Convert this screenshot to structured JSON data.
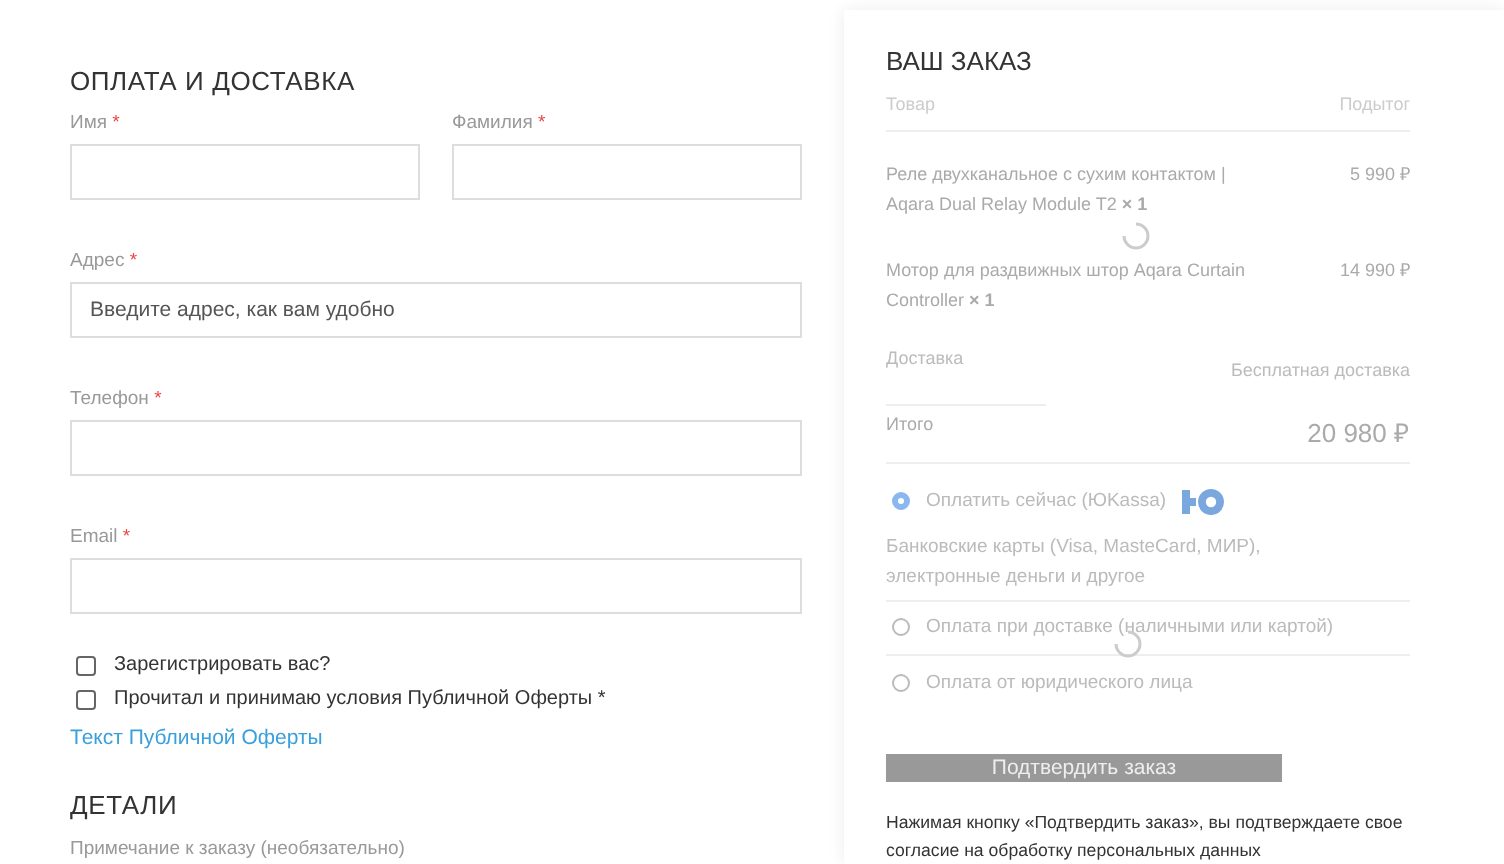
{
  "billing": {
    "title": "ОПЛАТА И ДОСТАВКА",
    "name_fields": [
      {
        "label": "Имя",
        "required": "*"
      },
      {
        "label": "Фамилия",
        "required": "*"
      }
    ],
    "fields": [
      {
        "label": "Адрес",
        "required": "*",
        "placeholder": "Введите адрес, как вам удобно"
      },
      {
        "label": "Телефон",
        "required": "*"
      },
      {
        "label": "Email",
        "required": "*"
      }
    ],
    "checkboxes": [
      {
        "label": "Зарегистрировать вас?",
        "checked": false
      },
      {
        "label": "Прочитал и принимаю условия Публичной Оферты *",
        "checked": false
      }
    ],
    "link": "Текст Публичной Оферты"
  },
  "details": {
    "title": "ДЕТАЛИ",
    "note_label": "Примечание к заказу (необязательно)"
  },
  "order": {
    "title": "ВАШ ЗАКАЗ",
    "columns": [
      "Товар",
      "Подытог"
    ],
    "items": [
      {
        "name": "Реле двухканальное с сухим контактом | Aqara Dual Relay Module T2 **× 1**",
        "price": "5 990 ₽"
      },
      {
        "name": "Мотор для раздвижных штор Aqara Curtain Controller **× 1**",
        "price": "14 990 ₽"
      }
    ],
    "shipping": {
      "label": "Доставка",
      "value": "Бесплатная доставка"
    },
    "total": {
      "label": "Итого",
      "value": "20 980 ₽"
    },
    "payment_methods": [
      {
        "label": "Оплатить сейчас (ЮKassa)",
        "selected": true,
        "description": "Банковские карты (Visa, MasteCard, МИР), электронные деньги и другое"
      },
      {
        "label": "Оплата при доставке (наличными или картой)",
        "selected": false
      },
      {
        "label": "Оплата от юридического лица",
        "selected": false
      }
    ],
    "button": "Подтвердить заказ",
    "notice": "Нажимая кнопку «Подтвердить заказ», вы подтверждаете свое согласие на обработку персональных данных"
  }
}
